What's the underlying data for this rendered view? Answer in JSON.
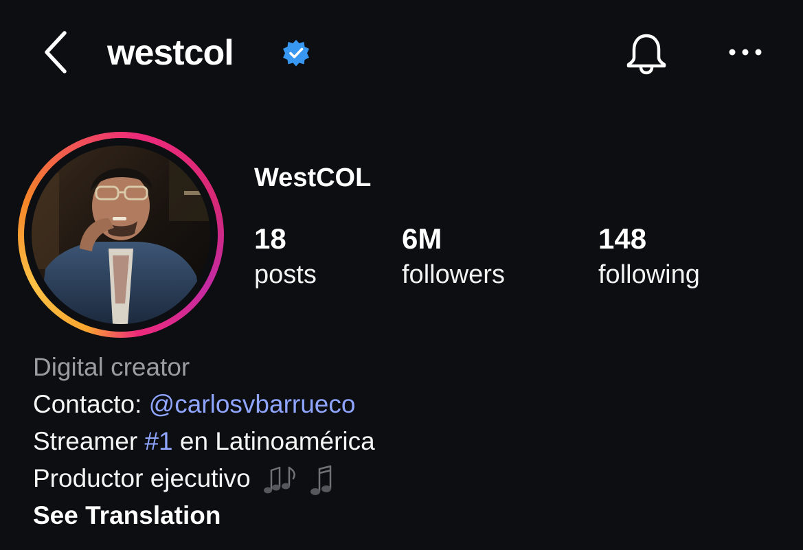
{
  "header": {
    "username": "westcol",
    "verified_color": "#3897f0",
    "icons": {
      "back": "chevron-left-icon",
      "verified": "verified-badge-icon",
      "notifications": "bell-icon",
      "more": "more-horizontal-icon"
    }
  },
  "profile": {
    "display_name": "WestCOL",
    "stats": [
      {
        "value": "18",
        "label": "posts"
      },
      {
        "value": "6M",
        "label": "followers"
      },
      {
        "value": "148",
        "label": "following"
      }
    ]
  },
  "bio": {
    "category": "Digital creator",
    "contact_prefix": "Contacto: ",
    "contact_handle": "@carlosvbarrueco",
    "line2_prefix": "Streamer ",
    "line2_hashtag": "#1",
    "line2_suffix": " en Latinoamérica",
    "line3_text": "Productor ejecutivo",
    "line3_icons": "music-notes-icon",
    "see_translation": "See Translation",
    "link_color": "#8fa5ff"
  }
}
